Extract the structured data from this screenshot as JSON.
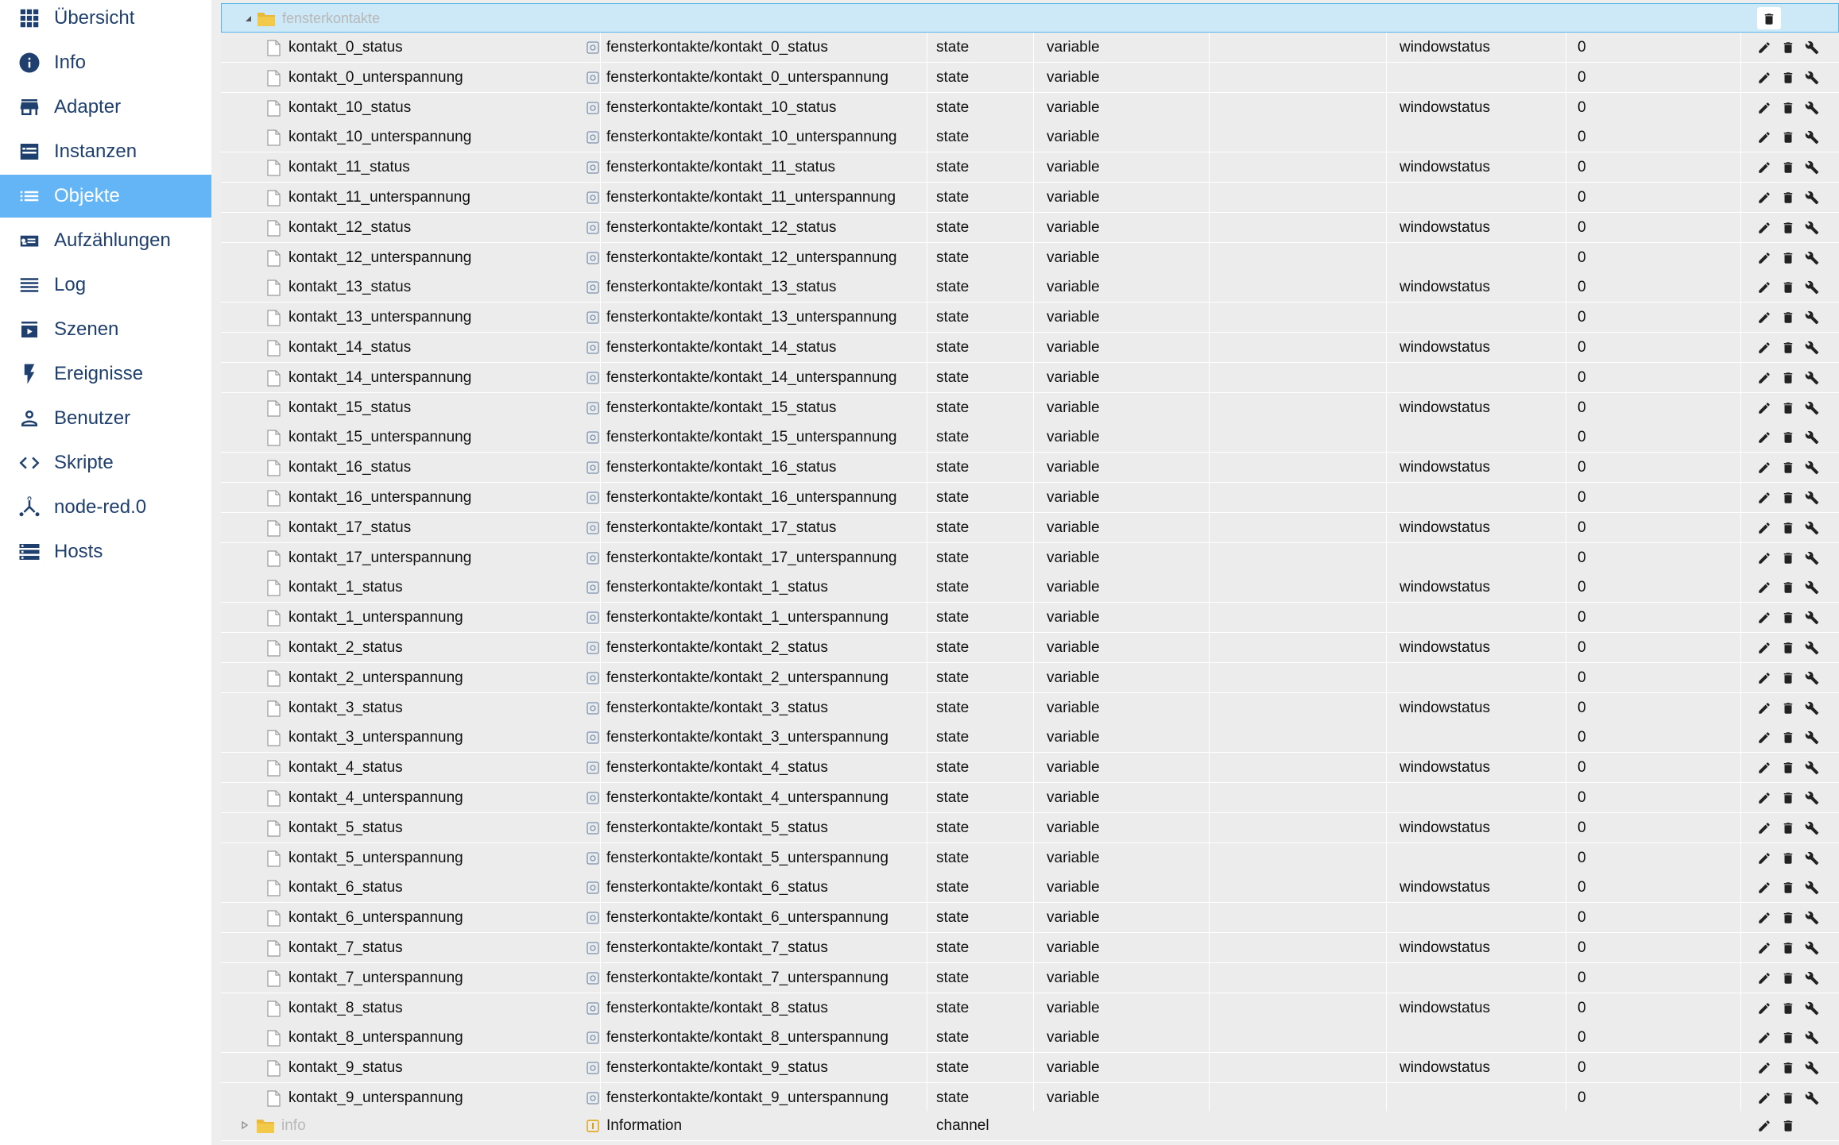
{
  "sidebar": {
    "items": [
      {
        "label": "Übersicht",
        "icon": "grid-icon",
        "active": false
      },
      {
        "label": "Info",
        "icon": "info-icon",
        "active": false
      },
      {
        "label": "Adapter",
        "icon": "store-icon",
        "active": false
      },
      {
        "label": "Instanzen",
        "icon": "instances-icon",
        "active": false
      },
      {
        "label": "Objekte",
        "icon": "list-icon",
        "active": true
      },
      {
        "label": "Aufzählungen",
        "icon": "enum-icon",
        "active": false
      },
      {
        "label": "Log",
        "icon": "log-icon",
        "active": false
      },
      {
        "label": "Szenen",
        "icon": "scenes-icon",
        "active": false
      },
      {
        "label": "Ereignisse",
        "icon": "lightning-icon",
        "active": false
      },
      {
        "label": "Benutzer",
        "icon": "user-icon",
        "active": false
      },
      {
        "label": "Skripte",
        "icon": "code-icon",
        "active": false
      },
      {
        "label": "node-red.0",
        "icon": "node-red-icon",
        "active": false
      },
      {
        "label": "Hosts",
        "icon": "hosts-icon",
        "active": false
      }
    ]
  },
  "tree": {
    "folder": {
      "name": "fensterkontakte",
      "expanded": true
    },
    "rows": [
      {
        "name": "kontakt_0_status",
        "id": "fensterkontakte/kontakt_0_status",
        "type": "state",
        "role": "variable",
        "room": "",
        "func": "windowstatus",
        "value": "0"
      },
      {
        "name": "kontakt_0_unterspannung",
        "id": "fensterkontakte/kontakt_0_unterspannung",
        "type": "state",
        "role": "variable",
        "room": "",
        "func": "",
        "value": "0"
      },
      {
        "name": "kontakt_10_status",
        "id": "fensterkontakte/kontakt_10_status",
        "type": "state",
        "role": "variable",
        "room": "",
        "func": "windowstatus",
        "value": "0"
      },
      {
        "name": "kontakt_10_unterspannung",
        "id": "fensterkontakte/kontakt_10_unterspannung",
        "type": "state",
        "role": "variable",
        "room": "",
        "func": "",
        "value": "0"
      },
      {
        "name": "kontakt_11_status",
        "id": "fensterkontakte/kontakt_11_status",
        "type": "state",
        "role": "variable",
        "room": "",
        "func": "windowstatus",
        "value": "0"
      },
      {
        "name": "kontakt_11_unterspannung",
        "id": "fensterkontakte/kontakt_11_unterspannung",
        "type": "state",
        "role": "variable",
        "room": "",
        "func": "",
        "value": "0"
      },
      {
        "name": "kontakt_12_status",
        "id": "fensterkontakte/kontakt_12_status",
        "type": "state",
        "role": "variable",
        "room": "",
        "func": "windowstatus",
        "value": "0"
      },
      {
        "name": "kontakt_12_unterspannung",
        "id": "fensterkontakte/kontakt_12_unterspannung",
        "type": "state",
        "role": "variable",
        "room": "",
        "func": "",
        "value": "0"
      },
      {
        "name": "kontakt_13_status",
        "id": "fensterkontakte/kontakt_13_status",
        "type": "state",
        "role": "variable",
        "room": "",
        "func": "windowstatus",
        "value": "0"
      },
      {
        "name": "kontakt_13_unterspannung",
        "id": "fensterkontakte/kontakt_13_unterspannung",
        "type": "state",
        "role": "variable",
        "room": "",
        "func": "",
        "value": "0"
      },
      {
        "name": "kontakt_14_status",
        "id": "fensterkontakte/kontakt_14_status",
        "type": "state",
        "role": "variable",
        "room": "",
        "func": "windowstatus",
        "value": "0"
      },
      {
        "name": "kontakt_14_unterspannung",
        "id": "fensterkontakte/kontakt_14_unterspannung",
        "type": "state",
        "role": "variable",
        "room": "",
        "func": "",
        "value": "0"
      },
      {
        "name": "kontakt_15_status",
        "id": "fensterkontakte/kontakt_15_status",
        "type": "state",
        "role": "variable",
        "room": "",
        "func": "windowstatus",
        "value": "0"
      },
      {
        "name": "kontakt_15_unterspannung",
        "id": "fensterkontakte/kontakt_15_unterspannung",
        "type": "state",
        "role": "variable",
        "room": "",
        "func": "",
        "value": "0"
      },
      {
        "name": "kontakt_16_status",
        "id": "fensterkontakte/kontakt_16_status",
        "type": "state",
        "role": "variable",
        "room": "",
        "func": "windowstatus",
        "value": "0"
      },
      {
        "name": "kontakt_16_unterspannung",
        "id": "fensterkontakte/kontakt_16_unterspannung",
        "type": "state",
        "role": "variable",
        "room": "",
        "func": "",
        "value": "0"
      },
      {
        "name": "kontakt_17_status",
        "id": "fensterkontakte/kontakt_17_status",
        "type": "state",
        "role": "variable",
        "room": "",
        "func": "windowstatus",
        "value": "0"
      },
      {
        "name": "kontakt_17_unterspannung",
        "id": "fensterkontakte/kontakt_17_unterspannung",
        "type": "state",
        "role": "variable",
        "room": "",
        "func": "",
        "value": "0"
      },
      {
        "name": "kontakt_1_status",
        "id": "fensterkontakte/kontakt_1_status",
        "type": "state",
        "role": "variable",
        "room": "",
        "func": "windowstatus",
        "value": "0"
      },
      {
        "name": "kontakt_1_unterspannung",
        "id": "fensterkontakte/kontakt_1_unterspannung",
        "type": "state",
        "role": "variable",
        "room": "",
        "func": "",
        "value": "0"
      },
      {
        "name": "kontakt_2_status",
        "id": "fensterkontakte/kontakt_2_status",
        "type": "state",
        "role": "variable",
        "room": "",
        "func": "windowstatus",
        "value": "0"
      },
      {
        "name": "kontakt_2_unterspannung",
        "id": "fensterkontakte/kontakt_2_unterspannung",
        "type": "state",
        "role": "variable",
        "room": "",
        "func": "",
        "value": "0"
      },
      {
        "name": "kontakt_3_status",
        "id": "fensterkontakte/kontakt_3_status",
        "type": "state",
        "role": "variable",
        "room": "",
        "func": "windowstatus",
        "value": "0"
      },
      {
        "name": "kontakt_3_unterspannung",
        "id": "fensterkontakte/kontakt_3_unterspannung",
        "type": "state",
        "role": "variable",
        "room": "",
        "func": "",
        "value": "0"
      },
      {
        "name": "kontakt_4_status",
        "id": "fensterkontakte/kontakt_4_status",
        "type": "state",
        "role": "variable",
        "room": "",
        "func": "windowstatus",
        "value": "0"
      },
      {
        "name": "kontakt_4_unterspannung",
        "id": "fensterkontakte/kontakt_4_unterspannung",
        "type": "state",
        "role": "variable",
        "room": "",
        "func": "",
        "value": "0"
      },
      {
        "name": "kontakt_5_status",
        "id": "fensterkontakte/kontakt_5_status",
        "type": "state",
        "role": "variable",
        "room": "",
        "func": "windowstatus",
        "value": "0"
      },
      {
        "name": "kontakt_5_unterspannung",
        "id": "fensterkontakte/kontakt_5_unterspannung",
        "type": "state",
        "role": "variable",
        "room": "",
        "func": "",
        "value": "0"
      },
      {
        "name": "kontakt_6_status",
        "id": "fensterkontakte/kontakt_6_status",
        "type": "state",
        "role": "variable",
        "room": "",
        "func": "windowstatus",
        "value": "0"
      },
      {
        "name": "kontakt_6_unterspannung",
        "id": "fensterkontakte/kontakt_6_unterspannung",
        "type": "state",
        "role": "variable",
        "room": "",
        "func": "",
        "value": "0"
      },
      {
        "name": "kontakt_7_status",
        "id": "fensterkontakte/kontakt_7_status",
        "type": "state",
        "role": "variable",
        "room": "",
        "func": "windowstatus",
        "value": "0"
      },
      {
        "name": "kontakt_7_unterspannung",
        "id": "fensterkontakte/kontakt_7_unterspannung",
        "type": "state",
        "role": "variable",
        "room": "",
        "func": "",
        "value": "0"
      },
      {
        "name": "kontakt_8_status",
        "id": "fensterkontakte/kontakt_8_status",
        "type": "state",
        "role": "variable",
        "room": "",
        "func": "windowstatus",
        "value": "0"
      },
      {
        "name": "kontakt_8_unterspannung",
        "id": "fensterkontakte/kontakt_8_unterspannung",
        "type": "state",
        "role": "variable",
        "room": "",
        "func": "",
        "value": "0"
      },
      {
        "name": "kontakt_9_status",
        "id": "fensterkontakte/kontakt_9_status",
        "type": "state",
        "role": "variable",
        "room": "",
        "func": "windowstatus",
        "value": "0"
      },
      {
        "name": "kontakt_9_unterspannung",
        "id": "fensterkontakte/kontakt_9_unterspannung",
        "type": "state",
        "role": "variable",
        "room": "",
        "func": "",
        "value": "0"
      }
    ],
    "info_row": {
      "name": "info",
      "id": "Information",
      "type": "channel",
      "expanded": false
    }
  },
  "icons": {
    "row_actions": [
      "edit-icon",
      "delete-icon",
      "wrench-icon"
    ],
    "folder_actions": [
      "delete-icon"
    ]
  },
  "colors": {
    "accent": "#64b5f6",
    "nav_text": "#1f3f6e",
    "selected_row": "#cde8f6",
    "folder": "#e8b93b"
  }
}
